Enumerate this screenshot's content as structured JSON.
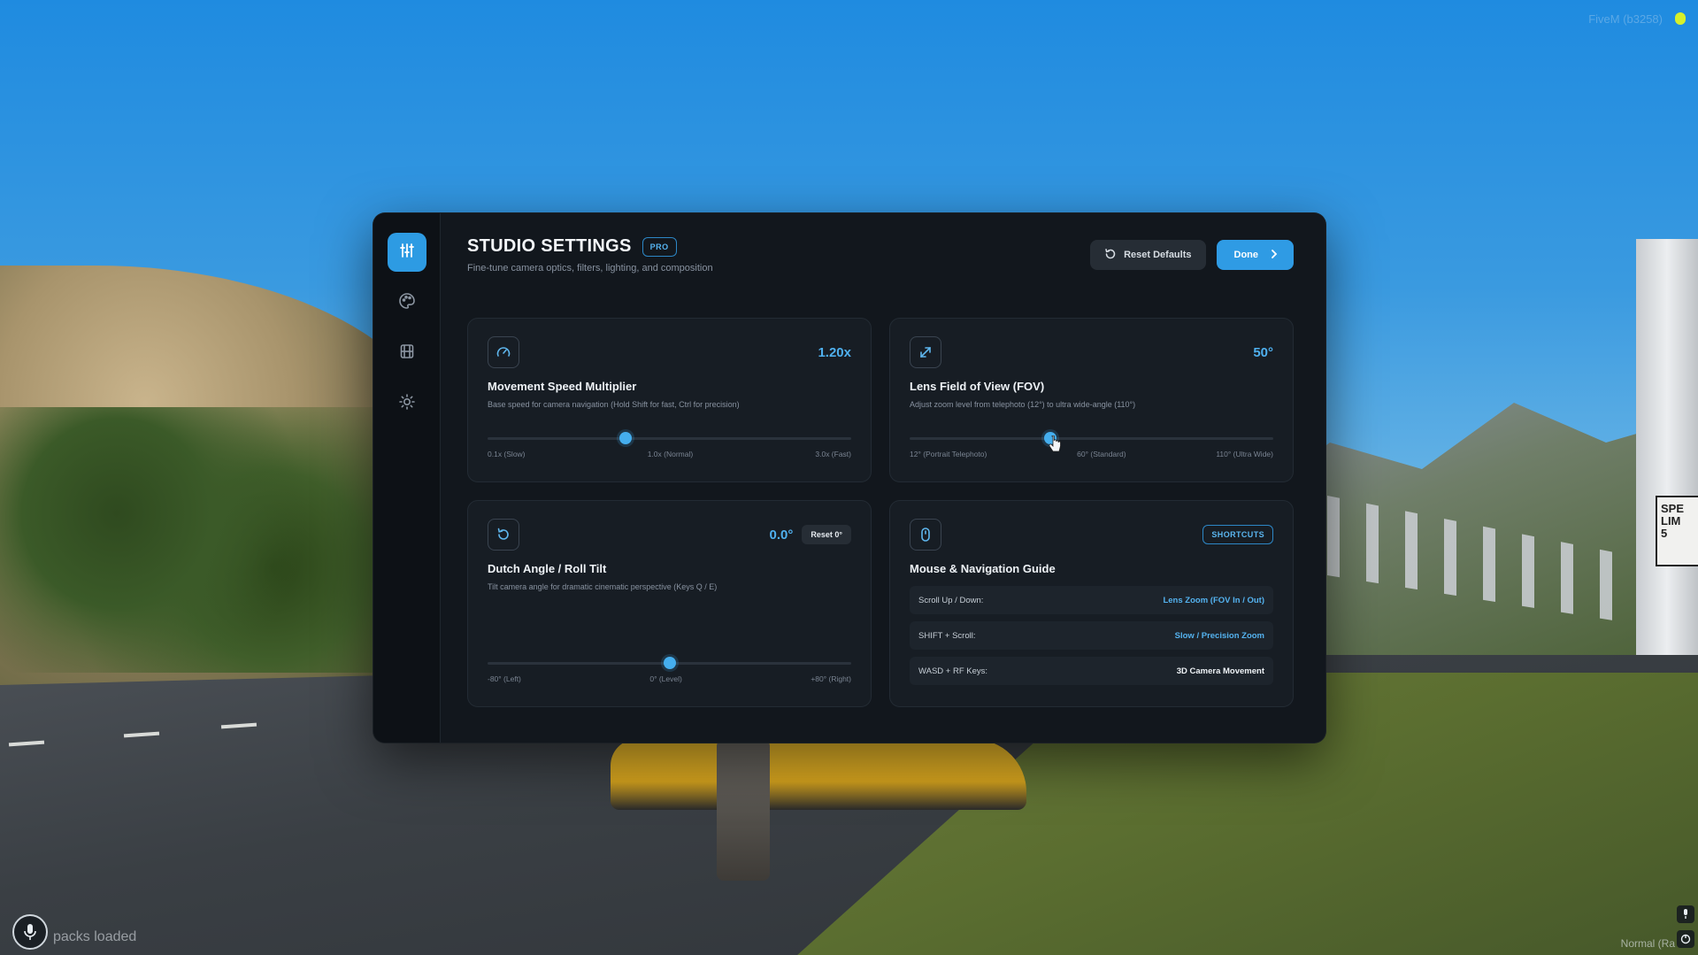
{
  "hud": {
    "status_text": "packs loaded",
    "top_right_text": "FiveM (b3258)",
    "bottom_right_text": "Normal (Ra"
  },
  "sidebar": {
    "items": [
      {
        "icon": "sliders-icon",
        "active": true
      },
      {
        "icon": "palette-icon",
        "active": false
      },
      {
        "icon": "film-icon",
        "active": false
      },
      {
        "icon": "sun-icon",
        "active": false
      }
    ]
  },
  "header": {
    "title": "STUDIO SETTINGS",
    "badge": "PRO",
    "subtitle": "Fine-tune camera optics, filters, lighting, and composition",
    "reset_label": "Reset Defaults",
    "done_label": "Done"
  },
  "speed": {
    "value": "1.20x",
    "title": "Movement Speed Multiplier",
    "description": "Base speed for camera navigation (Hold Shift for fast, Ctrl for precision)",
    "slider_fraction": 0.379,
    "ticks": [
      "0.1x (Slow)",
      "1.0x (Normal)",
      "3.0x (Fast)"
    ]
  },
  "fov": {
    "value": "50°",
    "title": "Lens Field of View (FOV)",
    "description": "Adjust zoom level from telephoto (12°) to ultra wide-angle (110°)",
    "slider_fraction": 0.388,
    "ticks": [
      "12° (Portrait Telephoto)",
      "60° (Standard)",
      "110° (Ultra Wide)"
    ]
  },
  "dutch": {
    "value": "0.0°",
    "reset_label": "Reset 0°",
    "title": "Dutch Angle / Roll Tilt",
    "description": "Tilt camera angle for dramatic cinematic perspective (Keys Q / E)",
    "slider_fraction": 0.5,
    "ticks": [
      "-80° (Left)",
      "0° (Level)",
      "+80° (Right)"
    ]
  },
  "guide": {
    "title": "Mouse & Navigation Guide",
    "badge": "SHORTCUTS",
    "rows": [
      {
        "key": "Scroll Up / Down:",
        "value": "Lens Zoom (FOV In / Out)"
      },
      {
        "key": "SHIFT + Scroll:",
        "value": "Slow / Precision Zoom"
      },
      {
        "key": "WASD + RF Keys:",
        "value": "3D Camera Movement"
      }
    ]
  },
  "colors": {
    "accent": "#2f9be4",
    "panel": "#12171d",
    "card": "#171d24"
  }
}
